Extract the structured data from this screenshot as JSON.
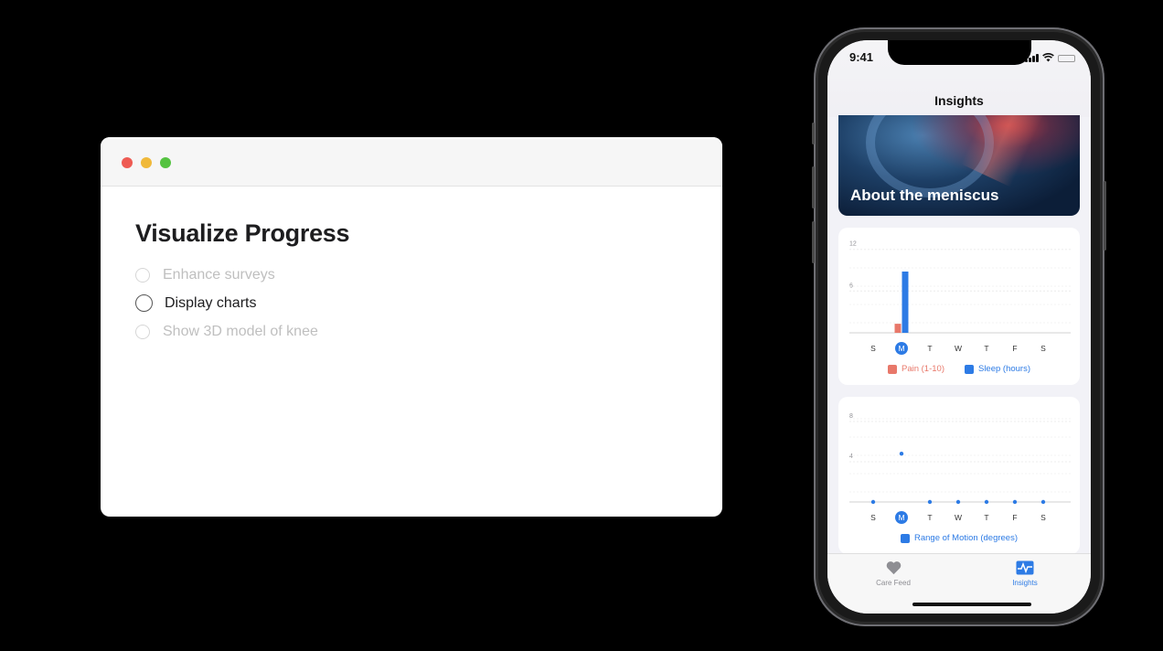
{
  "mac_window": {
    "title": "Visualize Progress",
    "tasks": [
      {
        "label": "Enhance surveys",
        "state": "dimmed"
      },
      {
        "label": "Display charts",
        "state": "active"
      },
      {
        "label": "Show 3D model of knee",
        "state": "dimmed"
      }
    ]
  },
  "phone": {
    "status": {
      "time": "9:41"
    },
    "nav_title": "Insights",
    "hero": {
      "title": "About the meniscus"
    },
    "tabs": [
      {
        "label": "Care Feed",
        "icon": "heart-icon",
        "selected": false
      },
      {
        "label": "Insights",
        "icon": "activity-chart-icon",
        "selected": true
      }
    ]
  },
  "colors": {
    "accent": "#2d7be5",
    "pain": "#e8786a",
    "tab_inactive": "#8e8e93"
  },
  "chart_data": [
    {
      "type": "bar",
      "categories": [
        "S",
        "M",
        "T",
        "W",
        "T",
        "F",
        "S"
      ],
      "selected_category": 1,
      "y_ticks": [
        6,
        12
      ],
      "ylim": [
        0,
        13
      ],
      "series": [
        {
          "name": "Pain (1-10)",
          "color": "#e8786a",
          "values": [
            0,
            1.3,
            0,
            0,
            0,
            0,
            0
          ]
        },
        {
          "name": "Sleep (hours)",
          "color": "#2d7be5",
          "values": [
            0,
            8.8,
            0,
            0,
            0,
            0,
            0
          ]
        }
      ]
    },
    {
      "type": "scatter",
      "categories": [
        "S",
        "M",
        "T",
        "W",
        "T",
        "F",
        "S"
      ],
      "selected_category": 1,
      "y_ticks": [
        4,
        8
      ],
      "ylim": [
        0,
        9
      ],
      "series": [
        {
          "name": "Range of Motion (degrees)",
          "color": "#2d7be5",
          "values": [
            0,
            4.8,
            0,
            0,
            0,
            0,
            0
          ]
        }
      ]
    }
  ]
}
